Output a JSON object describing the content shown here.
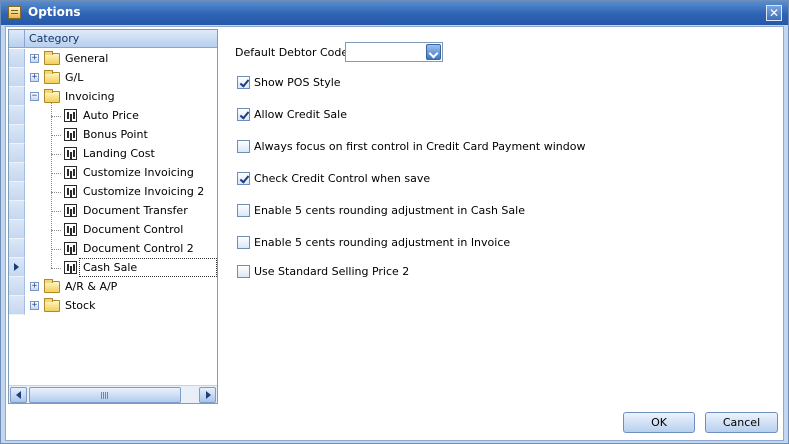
{
  "window": {
    "title": "Options",
    "close_glyph": "✕"
  },
  "tree": {
    "header": "Category",
    "expand_glyph": "+",
    "collapse_glyph": "−",
    "items": [
      {
        "label": "General",
        "level": 0,
        "type": "folder",
        "expander": "+"
      },
      {
        "label": "G/L",
        "level": 0,
        "type": "folder",
        "expander": "+"
      },
      {
        "label": "Invoicing",
        "level": 0,
        "type": "folder",
        "expander": "−"
      },
      {
        "label": "Auto Price",
        "level": 1,
        "type": "page"
      },
      {
        "label": "Bonus Point",
        "level": 1,
        "type": "page"
      },
      {
        "label": "Landing Cost",
        "level": 1,
        "type": "page"
      },
      {
        "label": "Customize Invoicing",
        "level": 1,
        "type": "page"
      },
      {
        "label": "Customize Invoicing 2",
        "level": 1,
        "type": "page"
      },
      {
        "label": "Document Transfer",
        "level": 1,
        "type": "page"
      },
      {
        "label": "Document Control",
        "level": 1,
        "type": "page"
      },
      {
        "label": "Document Control 2",
        "level": 1,
        "type": "page"
      },
      {
        "label": "Cash Sale",
        "level": 1,
        "type": "page",
        "selected": true
      },
      {
        "label": "A/R & A/P",
        "level": 0,
        "type": "folder",
        "expander": "+"
      },
      {
        "label": "Stock",
        "level": 0,
        "type": "folder",
        "expander": "+"
      }
    ]
  },
  "settings": {
    "default_debtor_label": "Default Debtor Code:",
    "default_debtor_value": "",
    "checkboxes": [
      {
        "label": "Show POS Style",
        "checked": true
      },
      {
        "label": "Allow Credit Sale",
        "checked": true
      },
      {
        "label": "Always focus on first control in Credit Card Payment window",
        "checked": false
      },
      {
        "label": "Check Credit Control when save",
        "checked": true
      },
      {
        "label": "Enable 5 cents rounding adjustment in Cash Sale",
        "checked": false
      },
      {
        "label": "Enable 5 cents rounding adjustment in Invoice",
        "checked": false
      },
      {
        "label": "Use Standard Selling Price 2",
        "checked": false
      }
    ]
  },
  "buttons": {
    "ok": "OK",
    "cancel": "Cancel"
  },
  "colors": {
    "title_bar": "#2e63b4",
    "frame": "#c2d6ef",
    "accent": "#1d3c7c"
  }
}
